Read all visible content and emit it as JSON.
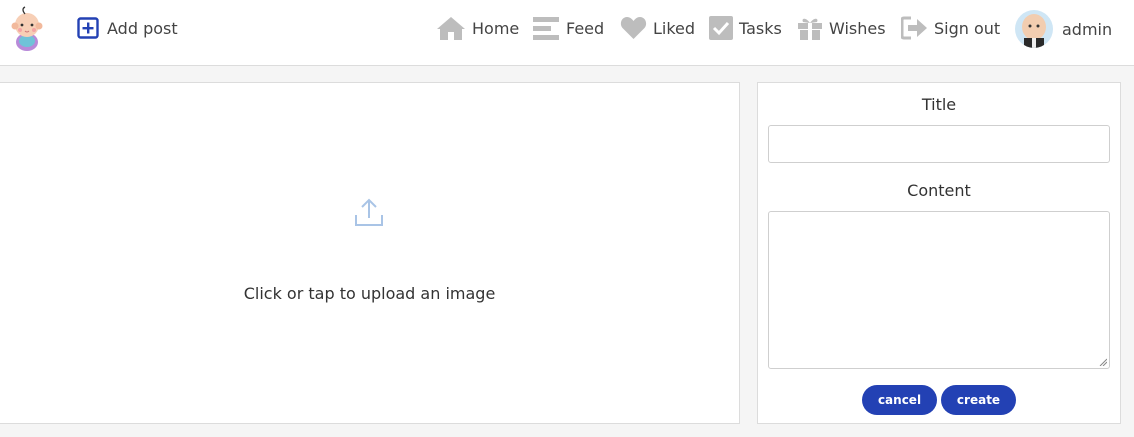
{
  "navbar": {
    "add_post_label": "Add post",
    "items": [
      {
        "label": "Home",
        "icon": "home-icon"
      },
      {
        "label": "Feed",
        "icon": "feed-icon"
      },
      {
        "label": "Liked",
        "icon": "heart-icon"
      },
      {
        "label": "Tasks",
        "icon": "checkbox-icon"
      },
      {
        "label": "Wishes",
        "icon": "gift-icon"
      },
      {
        "label": "Sign out",
        "icon": "sign-out-icon"
      }
    ],
    "user": {
      "name": "admin"
    }
  },
  "upload": {
    "prompt": "Click or tap to upload an image"
  },
  "form": {
    "title_label": "Title",
    "title_value": "",
    "content_label": "Content",
    "content_value": "",
    "cancel_label": "cancel",
    "create_label": "create"
  },
  "colors": {
    "accent": "#2341b4",
    "nav_icon": "#bdbdbd",
    "upload_icon": "#a9c4e6"
  }
}
